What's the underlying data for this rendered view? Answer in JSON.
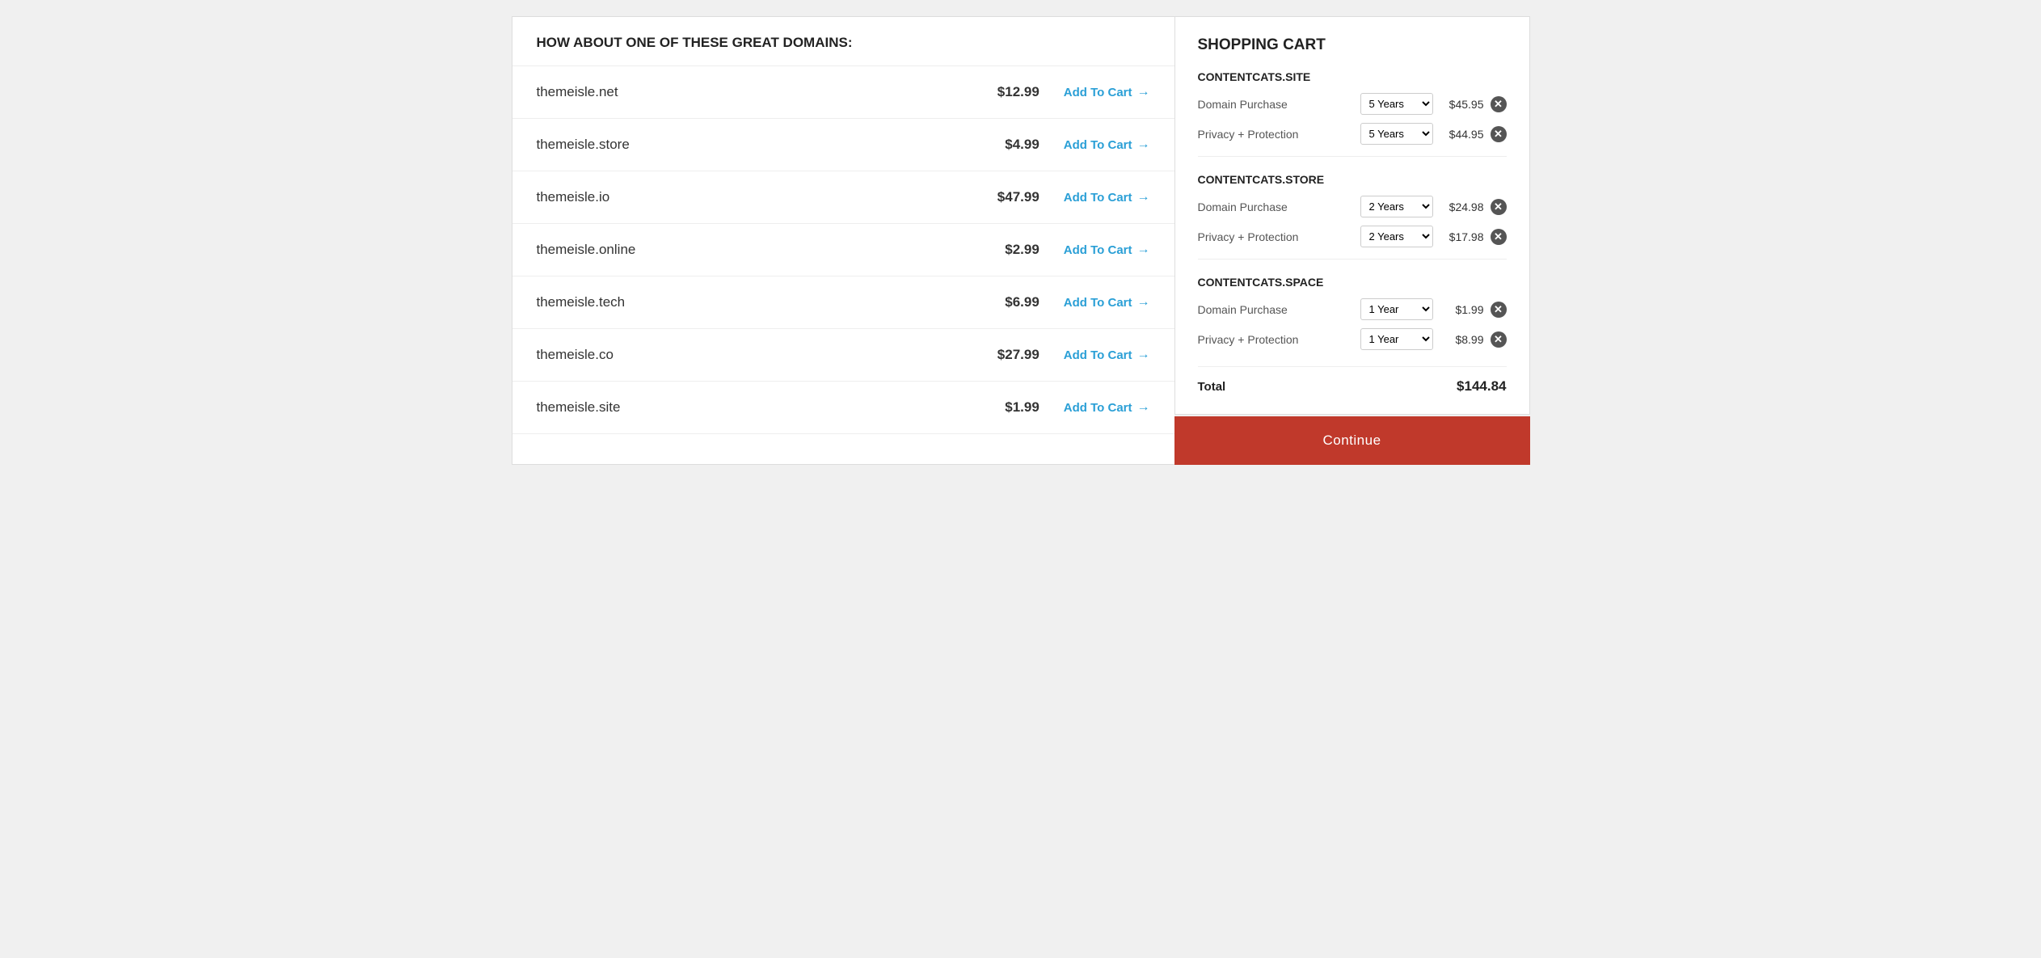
{
  "left": {
    "header": "HOW ABOUT ONE OF THESE GREAT DOMAINS:",
    "domains": [
      {
        "name": "themeisle.net",
        "price": "$12.99",
        "addLabel": "Add To Cart"
      },
      {
        "name": "themeisle.store",
        "price": "$4.99",
        "addLabel": "Add To Cart"
      },
      {
        "name": "themeisle.io",
        "price": "$47.99",
        "addLabel": "Add To Cart"
      },
      {
        "name": "themeisle.online",
        "price": "$2.99",
        "addLabel": "Add To Cart"
      },
      {
        "name": "themeisle.tech",
        "price": "$6.99",
        "addLabel": "Add To Cart"
      },
      {
        "name": "themeisle.co",
        "price": "$27.99",
        "addLabel": "Add To Cart"
      },
      {
        "name": "themeisle.site",
        "price": "$1.99",
        "addLabel": "Add To Cart"
      }
    ]
  },
  "cart": {
    "title": "SHOPPING CART",
    "sections": [
      {
        "name": "CONTENTCATS.SITE",
        "items": [
          {
            "label": "Domain Purchase",
            "duration": "5 Years",
            "price": "$45.95"
          },
          {
            "label": "Privacy + Protection",
            "duration": "5 Years",
            "price": "$44.95"
          }
        ]
      },
      {
        "name": "CONTENTCATS.STORE",
        "items": [
          {
            "label": "Domain Purchase",
            "duration": "2 Years",
            "price": "$24.98"
          },
          {
            "label": "Privacy + Protection",
            "duration": "2 Years",
            "price": "$17.98"
          }
        ]
      },
      {
        "name": "CONTENTCATS.SPACE",
        "items": [
          {
            "label": "Domain Purchase",
            "duration": "1 Year",
            "price": "$1.99"
          },
          {
            "label": "Privacy + Protection",
            "duration": "1 Year",
            "price": "$8.99"
          }
        ]
      }
    ],
    "total_label": "Total",
    "total_price": "$144.84",
    "continue_label": "Continue"
  }
}
